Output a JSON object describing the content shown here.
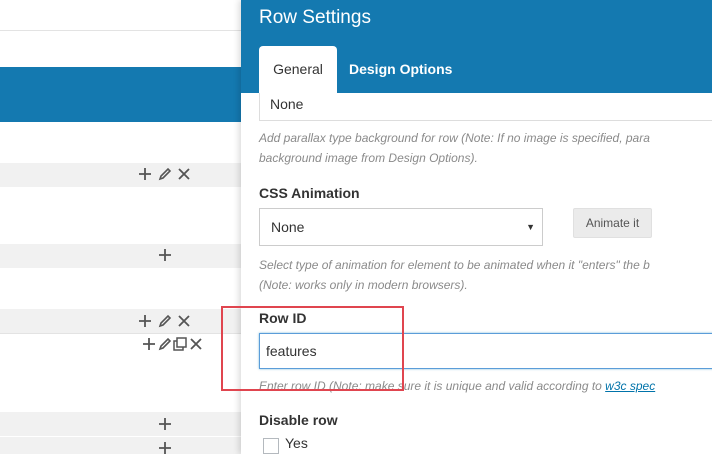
{
  "panel": {
    "title": "Row Settings",
    "tabs": [
      {
        "label": "General",
        "active": true
      },
      {
        "label": "Design Options",
        "active": false
      }
    ]
  },
  "parallax": {
    "value": "None",
    "help_line1": "Add parallax type background for row (Note: If no image is specified, para",
    "help_line2": "background image from Design Options)."
  },
  "css_animation": {
    "label": "CSS Animation",
    "value": "None",
    "button": "Animate it",
    "help_line1": "Select type of animation for element to be animated when it \"enters\" the b",
    "help_line2": "(Note: works only in modern browsers)."
  },
  "row_id": {
    "label": "Row ID",
    "value": "features",
    "help_prefix": "Enter row ID (Note: make sure it is unique and valid according to ",
    "help_link": "w3c spec"
  },
  "disable_row": {
    "label": "Disable row",
    "option": "Yes",
    "checked": false
  },
  "colors": {
    "header_blue": "#1479b0",
    "highlight_red": "#e0454f",
    "focus_blue": "#5b9dd9"
  },
  "background_controls": {
    "icons": [
      "plus-icon",
      "pencil-icon",
      "close-icon",
      "clone-icon"
    ]
  }
}
